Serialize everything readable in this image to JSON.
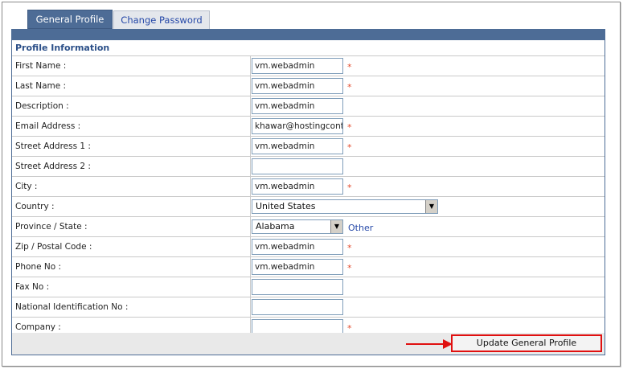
{
  "tabs": [
    {
      "label": "General Profile",
      "active": true
    },
    {
      "label": "Change Password",
      "active": false
    }
  ],
  "section_title": "Profile Information",
  "fields": [
    {
      "label": "First Name :",
      "value": "vm.webadmin",
      "required": true
    },
    {
      "label": "Last Name :",
      "value": "vm.webadmin",
      "required": true
    },
    {
      "label": "Description :",
      "value": "vm.webadmin",
      "required": false
    },
    {
      "label": "Email Address :",
      "value": "khawar@hostingcont",
      "required": true
    },
    {
      "label": "Street Address 1 :",
      "value": "vm.webadmin",
      "required": true
    },
    {
      "label": "Street Address 2 :",
      "value": "",
      "required": false
    },
    {
      "label": "City :",
      "value": "vm.webadmin",
      "required": true
    },
    {
      "label": "Country :",
      "value": "United States"
    },
    {
      "label": "Province / State :",
      "value": "Alabama",
      "other_link": "Other"
    },
    {
      "label": "Zip / Postal Code :",
      "value": "vm.webadmin",
      "required": true
    },
    {
      "label": "Phone No :",
      "value": "vm.webadmin",
      "required": true
    },
    {
      "label": "Fax No :",
      "value": "",
      "required": false
    },
    {
      "label": "National Identification No :",
      "value": "",
      "required": false
    },
    {
      "label": "Company :",
      "value": "",
      "required": true
    }
  ],
  "required_marker": "*",
  "update_button": "Update General Profile",
  "colors": {
    "tab_active": "#4d6c96",
    "required": "#e24a2c",
    "annotation": "#e01010"
  }
}
